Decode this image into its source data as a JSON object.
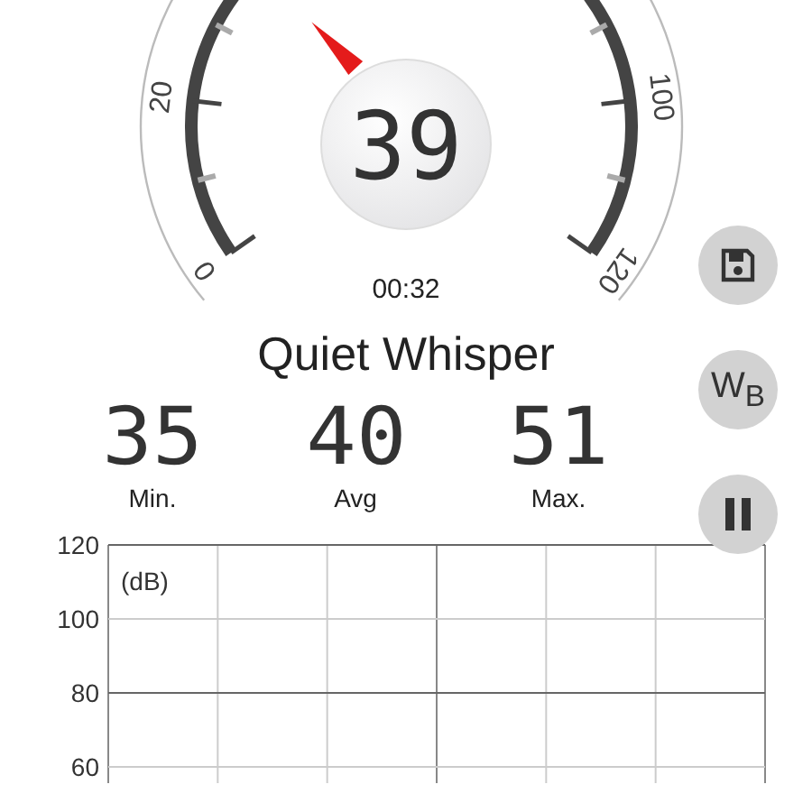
{
  "gauge": {
    "scale_labels": [
      "0",
      "20",
      "100",
      "120"
    ],
    "reading": "39"
  },
  "elapsed": "00:32",
  "noise_label": "Quiet Whisper",
  "stats": [
    {
      "value": "35",
      "label": "Min."
    },
    {
      "value": "40",
      "label": "Avg"
    },
    {
      "value": "51",
      "label": "Max."
    }
  ],
  "side_buttons": [
    {
      "kind": "save"
    },
    {
      "kind": "text",
      "label": "W$_{B}$"
    },
    {
      "kind": "pause"
    }
  ],
  "level_graph": {
    "unit": "(dB)",
    "y_labels": [
      "120",
      "100",
      "80",
      "60"
    ]
  }
}
